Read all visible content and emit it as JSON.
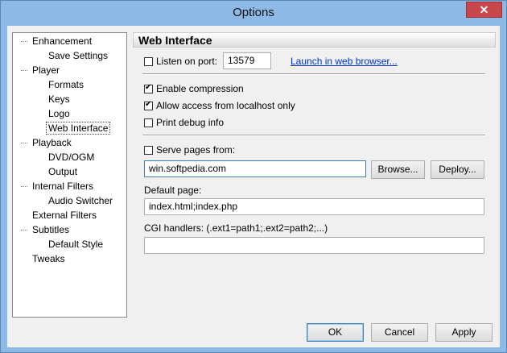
{
  "window": {
    "title": "Options",
    "close_glyph": "✕"
  },
  "tree": {
    "items": [
      {
        "label": "Enhancement"
      },
      {
        "label": "Save Settings"
      },
      {
        "label": "Player"
      },
      {
        "label": "Formats"
      },
      {
        "label": "Keys"
      },
      {
        "label": "Logo"
      },
      {
        "label": "Web Interface"
      },
      {
        "label": "Playback"
      },
      {
        "label": "DVD/OGM"
      },
      {
        "label": "Output"
      },
      {
        "label": "Internal Filters"
      },
      {
        "label": "Audio Switcher"
      },
      {
        "label": "External Filters"
      },
      {
        "label": "Subtitles"
      },
      {
        "label": "Default Style"
      },
      {
        "label": "Tweaks"
      }
    ],
    "selected": "Web Interface"
  },
  "page": {
    "header": "Web Interface",
    "listen_label": "Listen on port:",
    "listen_checked": false,
    "port_value": "13579",
    "launch_link": "Launch in web browser...",
    "enable_compression": "Enable compression",
    "enable_compression_checked": true,
    "allow_localhost": "Allow access from localhost only",
    "allow_localhost_checked": true,
    "print_debug": "Print debug info",
    "print_debug_checked": false,
    "serve_pages": "Serve pages from:",
    "serve_pages_checked": false,
    "serve_path": "win.softpedia.com",
    "browse_button": "Browse...",
    "deploy_button": "Deploy...",
    "default_page_label": "Default page:",
    "default_page_value": "index.html;index.php",
    "cgi_label": "CGI handlers: (.ext1=path1;.ext2=path2;...)",
    "cgi_value": ""
  },
  "buttons": {
    "ok": "OK",
    "cancel": "Cancel",
    "apply": "Apply"
  }
}
